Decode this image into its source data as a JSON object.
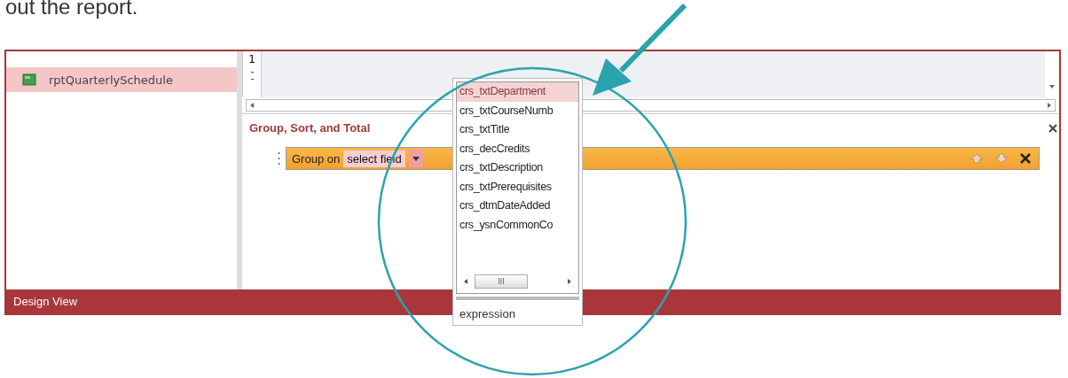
{
  "caption": "out the report.",
  "nav": {
    "items": [
      {
        "label": "rptQuarterlySchedule",
        "selected": true
      }
    ]
  },
  "ruler": {
    "label": "1"
  },
  "group_section": {
    "title": "Group, Sort, and Total"
  },
  "group_bar": {
    "label": "Group on",
    "field": "select field"
  },
  "dropdown": {
    "items": [
      {
        "label": "crs_txtDepartment",
        "selected": true
      },
      {
        "label": "crs_txtCourseNumb",
        "selected": false
      },
      {
        "label": "crs_txtTitle",
        "selected": false
      },
      {
        "label": "crs_decCredits",
        "selected": false
      },
      {
        "label": "crs_txtDescription",
        "selected": false
      },
      {
        "label": "crs_txtPrerequisites",
        "selected": false
      },
      {
        "label": "crs_dtmDateAdded",
        "selected": false
      },
      {
        "label": "crs_ysnCommonCo",
        "selected": false
      }
    ],
    "scroll_label": "III",
    "footer": "expression"
  },
  "status_bar": {
    "label": "Design View"
  }
}
